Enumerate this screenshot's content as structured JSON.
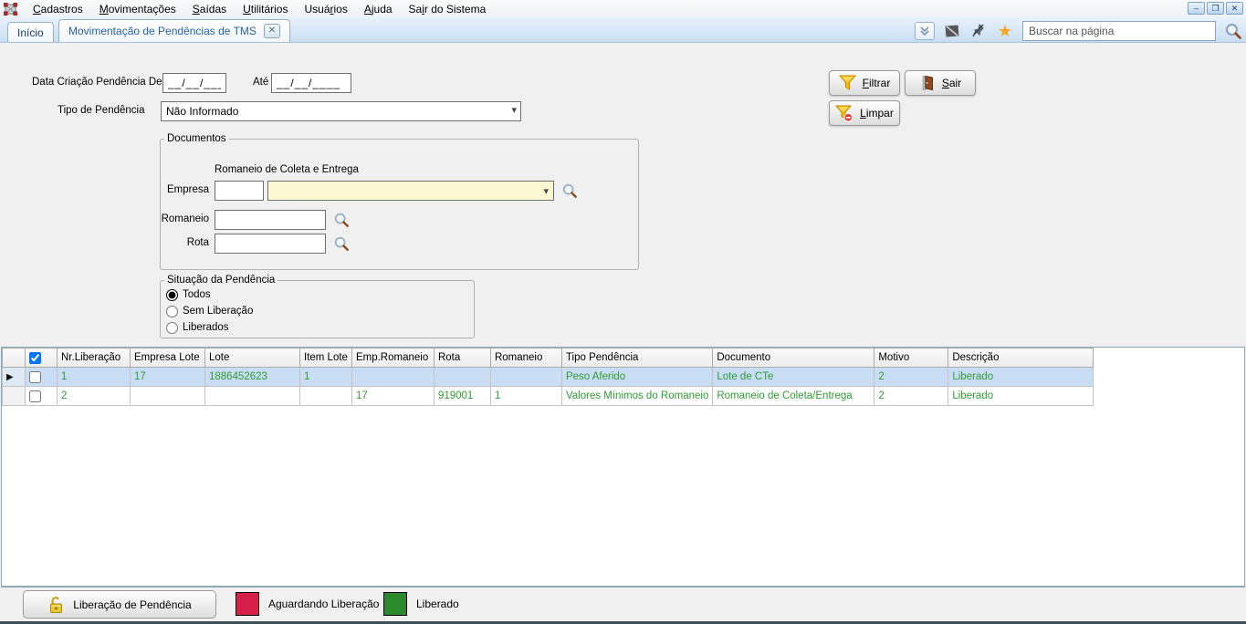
{
  "window": {
    "controls": {
      "minimize": "–",
      "restore": "❐",
      "close": "✕"
    }
  },
  "menu": {
    "items": [
      {
        "label": "Cadastros",
        "accel_index": 0
      },
      {
        "label": "Movimentações",
        "accel_index": 0
      },
      {
        "label": "Saídas",
        "accel_index": 0
      },
      {
        "label": "Utilitários",
        "accel_index": 0
      },
      {
        "label": "Usuários",
        "accel_index": 4
      },
      {
        "label": "Ajuda",
        "accel_index": 0
      },
      {
        "label": "Sair do Sistema",
        "accel_index": 2
      }
    ]
  },
  "tabs": {
    "inicio": "Início",
    "active": "Movimentação de Pendências de TMS",
    "close_glyph": "✕",
    "search_placeholder": "Buscar na página"
  },
  "filters": {
    "date_label": "Data Criação Pendência De",
    "date_from_value": "__/__/____",
    "date_to_label": "Até",
    "date_to_value": "__/__/____",
    "tipo_label": "Tipo de Pendência",
    "tipo_value": "Não Informado",
    "buttons": {
      "filtrar": {
        "label": "Filtrar",
        "accel_index": 0
      },
      "sair": {
        "label": "Sair",
        "accel_index": 0
      },
      "limpar": {
        "label": "Limpar",
        "accel_index": 0
      }
    }
  },
  "documentos": {
    "title": "Documentos",
    "subtitle": "Romaneio de Coleta e Entrega",
    "empresa_label": "Empresa",
    "romaneio_label": "Romaneio",
    "rota_label": "Rota"
  },
  "situacao": {
    "title": "Situação da Pendência",
    "options": [
      {
        "label": "Todos",
        "selected": true
      },
      {
        "label": "Sem Liberação",
        "selected": false
      },
      {
        "label": "Liberados",
        "selected": false
      }
    ]
  },
  "grid": {
    "columns": [
      "Nr.Liberação",
      "Empresa Lote",
      "Lote",
      "Item Lote",
      "Emp.Romaneio",
      "Rota",
      "Romaneio",
      "Tipo Pendência",
      "Documento",
      "Motivo",
      "Descrição"
    ],
    "header_checkbox_checked": true,
    "rows": [
      {
        "selected": true,
        "checked": false,
        "cells": [
          "1",
          "17",
          "1886452623",
          "1",
          "",
          "",
          "",
          "Peso Aferido",
          "Lote de CTe",
          "2",
          "Liberado"
        ]
      },
      {
        "selected": false,
        "checked": false,
        "cells": [
          "2",
          "",
          "",
          "",
          "17",
          "919001",
          "1",
          "Valores Mínimos do Romaneio",
          "Romaneio de Coleta/Entrega",
          "2",
          "Liberado"
        ]
      }
    ]
  },
  "footer": {
    "liberar_button": "Liberação de Pendência",
    "legend": [
      {
        "color": "#d6204a",
        "label": "Aguardando Liberação"
      },
      {
        "color": "#2c8a2c",
        "label": "Liberado"
      }
    ]
  },
  "colors": {
    "selected_row": "#c9def5",
    "grid_text": "#2f9d33",
    "combo_yellow": "#fbf8d2",
    "tabbar": "#cfe0f2",
    "legend_red": "#d6204a",
    "legend_green": "#2c8a2c"
  }
}
